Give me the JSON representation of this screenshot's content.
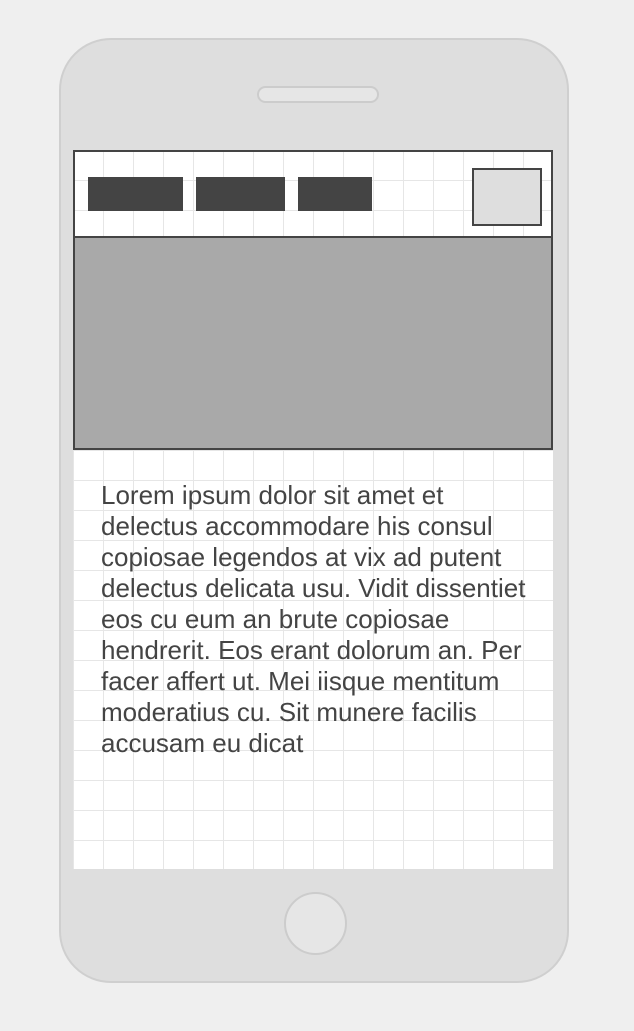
{
  "screen": {
    "nav": {
      "items": [
        "",
        "",
        ""
      ]
    },
    "content": {
      "body_text": "Lorem ipsum dolor sit amet et delectus accommodare his consul copiosae legendos at vix ad putent delectus delicata usu. Vidit dissentiet eos cu eum an brute copiosae hendrerit. Eos erant dolorum an. Per facer affert ut. Mei iisque mentitum moderatius cu. Sit munere facilis accusam eu dicat"
    }
  },
  "colors": {
    "background": "#efefef",
    "phone_body": "#dedede",
    "ink": "#444444",
    "image_placeholder": "#a9a9a9",
    "grid_line": "#e6e6e6"
  }
}
